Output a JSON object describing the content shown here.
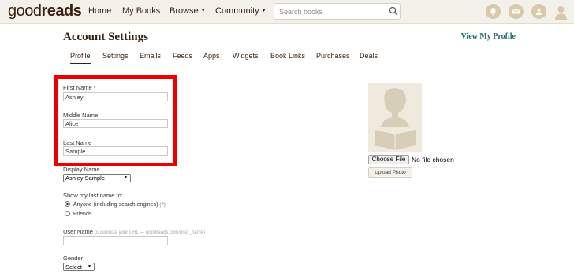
{
  "nav": {
    "logo_part1": "good",
    "logo_part2": "reads",
    "home": "Home",
    "my_books": "My Books",
    "browse": "Browse",
    "community": "Community",
    "search_placeholder": "Search books",
    "icons": [
      "bell-icon",
      "mail-icon",
      "friends-icon",
      "user-avatar-icon"
    ],
    "accent_color": "#382110",
    "bar_color": "#f4f1ea"
  },
  "header": {
    "title": "Account Settings",
    "view_profile": "View My Profile"
  },
  "tabs": [
    {
      "label": "Profile",
      "active": true
    },
    {
      "label": "Settings"
    },
    {
      "label": "Emails"
    },
    {
      "label": "Feeds"
    },
    {
      "label": "Apps"
    },
    {
      "label": "Widgets"
    },
    {
      "label": "Book Links"
    },
    {
      "label": "Purchases"
    },
    {
      "label": "Deals"
    }
  ],
  "form": {
    "first_name_label": "First Name",
    "required_mark": "*",
    "first_name_value": "Ashley",
    "middle_name_label": "Middle Name",
    "middle_name_value": "Alice",
    "last_name_label": "Last Name",
    "last_name_value": "Sample",
    "display_name_label": "Display Name",
    "display_name_value": "Ashley Sample",
    "show_last_name_label": "Show my last name to:",
    "radio_anyone": "Anyone (including search engines)",
    "radio_anyone_help": "(?)",
    "radio_friends": "Friends",
    "username_label": "User Name",
    "username_hint": "(customize your URL — goodreads.com/user_name)",
    "username_value": "",
    "gender_label": "Gender",
    "gender_value": "Select",
    "highlight_color": "#ee0000"
  },
  "photo": {
    "choose_file": "Choose File",
    "no_file": "No file chosen",
    "upload": "Upload Photo"
  }
}
